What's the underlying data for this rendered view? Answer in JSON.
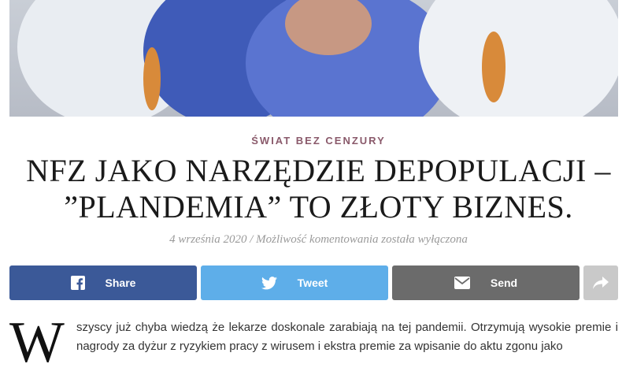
{
  "category": "ŚWIAT BEZ CENZURY",
  "title_line1": "NFZ JAKO NARZĘDZIE DEPOPULACJI –",
  "title_line2": "”PLANDEMIA” TO ZŁOTY BIZNES.",
  "meta": {
    "date": "4 września 2020",
    "separator": " / ",
    "comments": "Możliwość komentowania została wyłączona"
  },
  "share": {
    "facebook_label": "Share",
    "twitter_label": "Tweet",
    "email_label": "Send"
  },
  "body": {
    "dropcap": "W",
    "text": "szyscy już chyba wiedzą że lekarze doskonale zarabiają na tej pandemii. Otrzymują wysokie premie i nagrody za dyżur z ryzykiem pracy z wirusem i ekstra premie za wpisanie do aktu zgonu jako"
  },
  "colors": {
    "facebook": "#3b5998",
    "twitter": "#5eaee9",
    "email": "#6b6b6b",
    "more": "#c9c9c9",
    "category": "#8a5a6b"
  },
  "icons": [
    "facebook-icon",
    "twitter-icon",
    "email-icon",
    "share-arrow-icon"
  ]
}
